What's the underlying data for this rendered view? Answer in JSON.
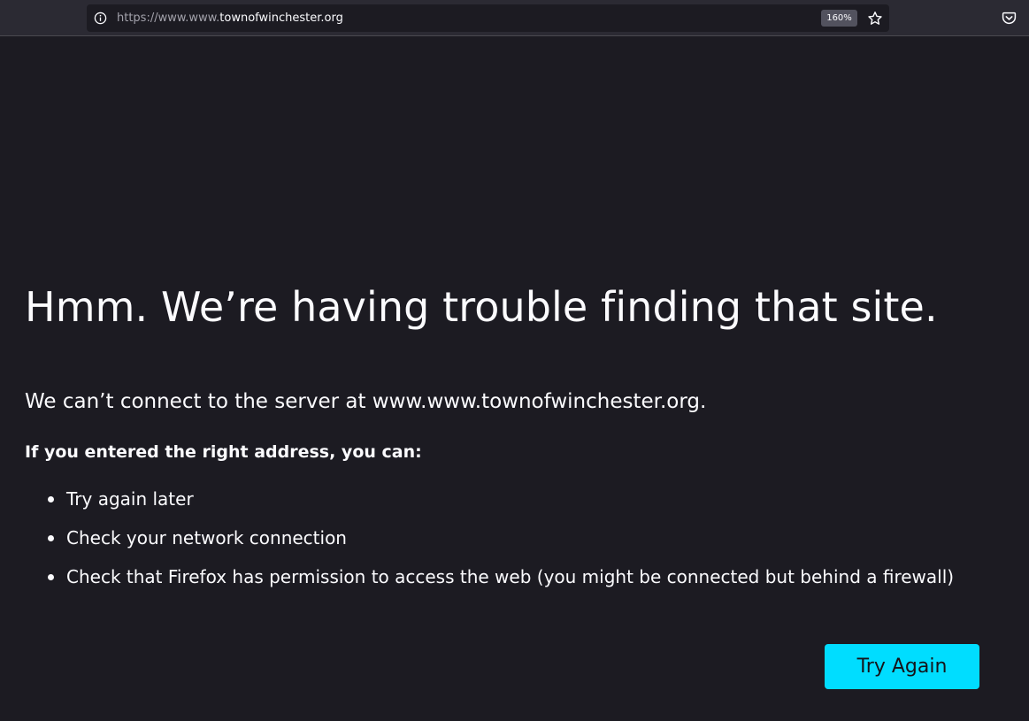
{
  "browser": {
    "url_prefix": "https://www.www.",
    "url_domain": "townofwinchester.org",
    "zoom_level": "160%",
    "icons": {
      "site_info": "info-icon",
      "bookmark": "star-icon",
      "pocket": "pocket-icon"
    }
  },
  "error_page": {
    "title": "Hmm. We’re having trouble finding that site.",
    "description": "We can’t connect to the server at www.www.townofwinchester.org.",
    "subheading": "If you entered the right address, you can:",
    "suggestions": [
      "Try again later",
      "Check your network connection",
      "Check that Firefox has permission to access the web (you might be connected but behind a firewall)"
    ],
    "try_again_label": "Try Again"
  },
  "colors": {
    "page_background": "#1c1b22",
    "toolbar_background": "#2b2a33",
    "text": "#fbfbfe",
    "button_accent": "#00ddff",
    "button_text": "#15141a"
  }
}
